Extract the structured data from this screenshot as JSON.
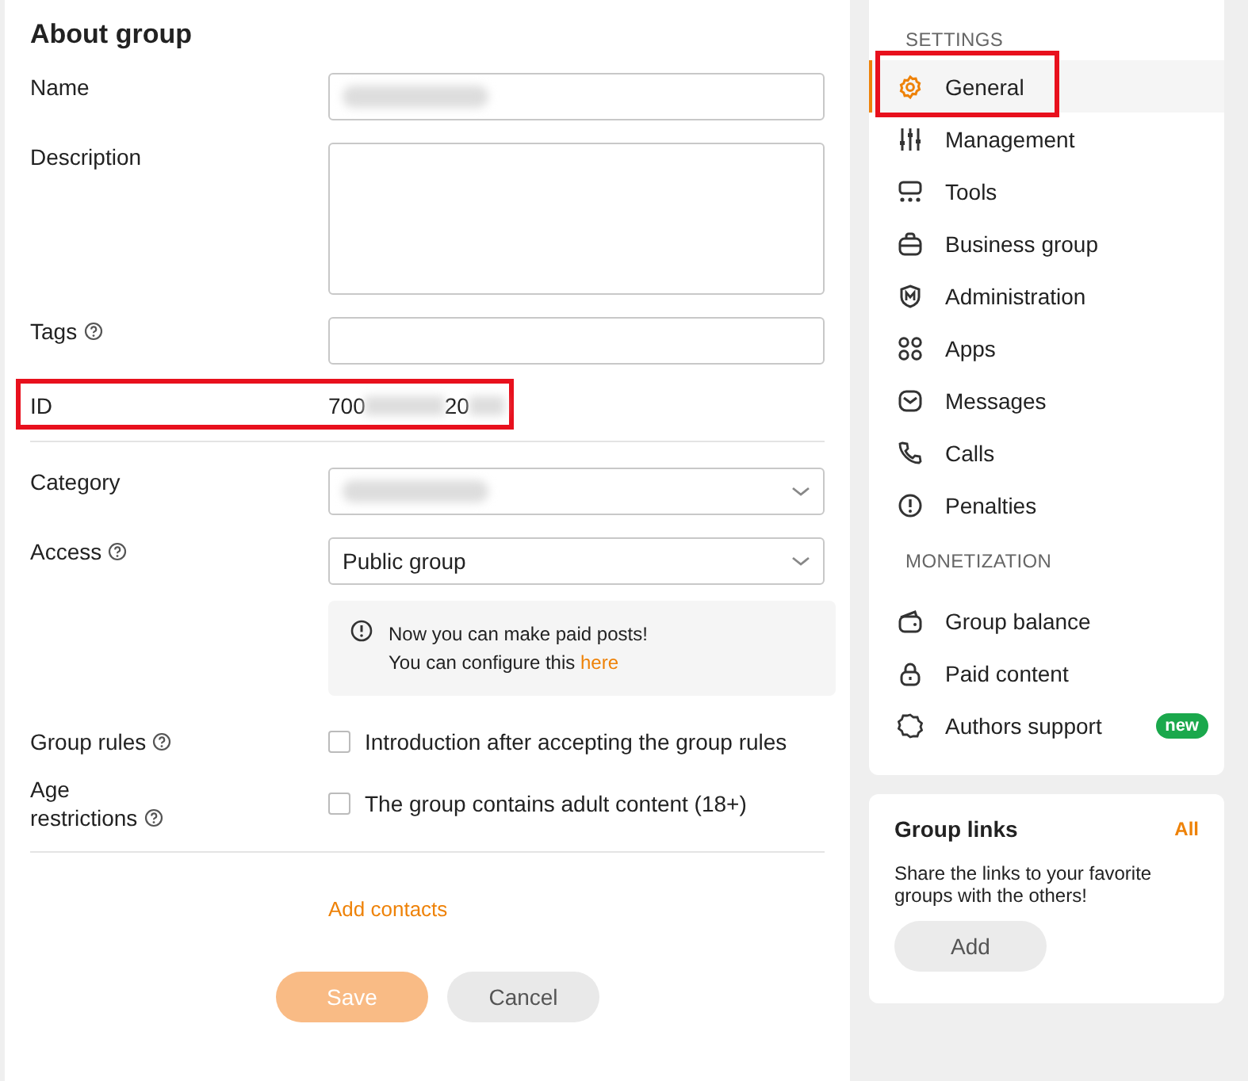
{
  "form": {
    "title": "About group",
    "fields": [
      {
        "kind": "text",
        "label": "Name",
        "help": false,
        "value_hidden": true
      },
      {
        "kind": "textarea",
        "label": "Description",
        "help": false
      },
      {
        "kind": "text",
        "label": "Tags",
        "help": true
      },
      {
        "kind": "id",
        "label": "ID",
        "help": false,
        "value_parts": [
          "700",
          "20"
        ],
        "highlighted": true
      },
      {
        "kind": "divider"
      },
      {
        "kind": "select",
        "label": "Category",
        "help": false,
        "value_hidden": true
      },
      {
        "kind": "select",
        "label": "Access",
        "help": true,
        "value": "Public group"
      },
      {
        "kind": "notice",
        "lines": [
          "Now you can make paid posts!",
          "You can configure this"
        ],
        "link": "here"
      },
      {
        "kind": "checkbox",
        "label": "Group rules",
        "help": true,
        "text": "Introduction after accepting the group rules",
        "checked": false
      },
      {
        "kind": "checkbox",
        "label": "Age restrictions",
        "help": true,
        "text": "The group contains adult content (18+)",
        "checked": false
      },
      {
        "kind": "divider"
      },
      {
        "kind": "link",
        "text": "Add contacts"
      }
    ],
    "buttons": [
      {
        "label": "Save",
        "kind": "primary",
        "disabled": true
      },
      {
        "label": "Cancel",
        "kind": "secondary",
        "disabled": false
      }
    ]
  },
  "sidebar": {
    "sections": [
      {
        "heading": "SETTINGS",
        "items": [
          {
            "label": "General",
            "selected": true,
            "highlighted": true
          },
          {
            "label": "Management",
            "selected": false,
            "highlighted": false
          },
          {
            "label": "Tools",
            "selected": false,
            "highlighted": false
          },
          {
            "label": "Business group",
            "selected": false,
            "highlighted": false
          },
          {
            "label": "Administration",
            "selected": false,
            "highlighted": false
          },
          {
            "label": "Apps",
            "selected": false,
            "highlighted": false
          },
          {
            "label": "Messages",
            "selected": false,
            "highlighted": false
          },
          {
            "label": "Calls",
            "selected": false,
            "highlighted": false
          },
          {
            "label": "Penalties",
            "selected": false,
            "highlighted": false
          }
        ]
      },
      {
        "heading": "MONETIZATION",
        "items": [
          {
            "label": "Group balance",
            "selected": false,
            "highlighted": false
          },
          {
            "label": "Paid content",
            "selected": false,
            "highlighted": false
          },
          {
            "label": "Authors support",
            "selected": false,
            "highlighted": false,
            "badge": "new"
          }
        ]
      }
    ]
  },
  "group_links": {
    "title": "Group links",
    "all_link": "All",
    "text": "Share the links to your favorite groups with the others!",
    "button": "Add"
  }
}
